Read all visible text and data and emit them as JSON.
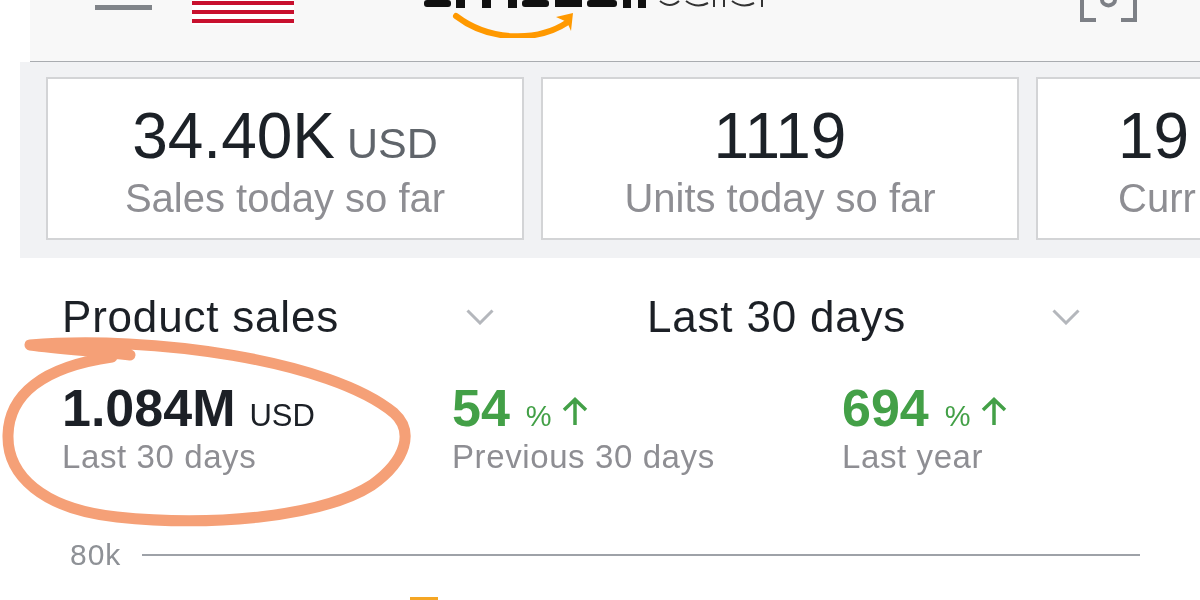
{
  "metrics": [
    {
      "value": "34.40K",
      "unit": "USD",
      "label": "Sales today so far"
    },
    {
      "value": "1119",
      "label": "Units today so far"
    },
    {
      "value": "19",
      "label": "Curr"
    }
  ],
  "selectors": [
    {
      "label": "Product sales"
    },
    {
      "label": "Last 30 days"
    }
  ],
  "stats": [
    {
      "kind": "total",
      "value": "1.084M",
      "unit": "USD",
      "label": "Last 30 days",
      "circled": true
    },
    {
      "kind": "change",
      "value": "54",
      "unit": "%",
      "increase": true,
      "label": "Previous 30 days",
      "circled": false
    },
    {
      "kind": "change",
      "value": "694",
      "unit": "%",
      "increase": true,
      "label": "Last year",
      "circled": false
    }
  ],
  "chart": {
    "y_tick": "80k"
  }
}
